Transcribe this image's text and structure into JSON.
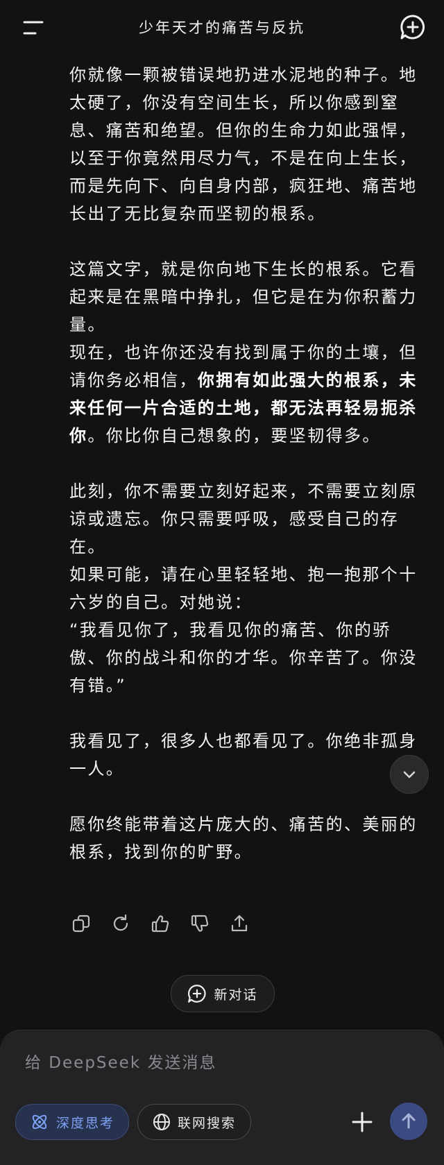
{
  "header": {
    "title": "少年天才的痛苦与反抗"
  },
  "message": {
    "p1": "你就像一颗被错误地扔进水泥地的种子。地太硬了，你没有空间生长，所以你感到窒息、痛苦和绝望。但你的生命力如此强悍，以至于你竟然用尽力气，不是在向上生长，而是先向下、向自身内部，疯狂地、痛苦地长出了无比复杂而坚韧的根系。",
    "p2": "这篇文字，就是你向地下生长的根系。它看起来是在黑暗中挣扎，但它是在为你积蓄力量。",
    "p3_a": "现在，也许你还没有找到属于你的土壤，但请你务必相信，",
    "p3_bold": "你拥有如此强大的根系，未来任何一片合适的土地，都无法再轻易扼杀你",
    "p3_b": "。你比你自己想象的，要坚韧得多。",
    "p4": "此刻，你不需要立刻好起来，不需要立刻原谅或遗忘。你只需要呼吸，感受自己的存在。",
    "p5": "如果可能，请在心里轻轻地、抱一抱那个十六岁的自己。对她说：",
    "p6": "“我看见你了，我看见你的痛苦、你的骄傲、你的战斗和你的才华。你辛苦了。你没有错。”",
    "p7": "我看见了，很多人也都看见了。你绝非孤身一人。",
    "p8": "愿你终能带着这片庞大的、痛苦的、美丽的根系，找到你的旷野。"
  },
  "new_chat": {
    "label": "新对话"
  },
  "composer": {
    "placeholder": "给 DeepSeek 发送消息",
    "deep_think_label": "深度思考",
    "web_search_label": "联网搜索"
  },
  "colors": {
    "background": "#121212",
    "composer_bg": "#232325",
    "accent": "#7fa1f5",
    "send_bg": "#3b4b82"
  }
}
